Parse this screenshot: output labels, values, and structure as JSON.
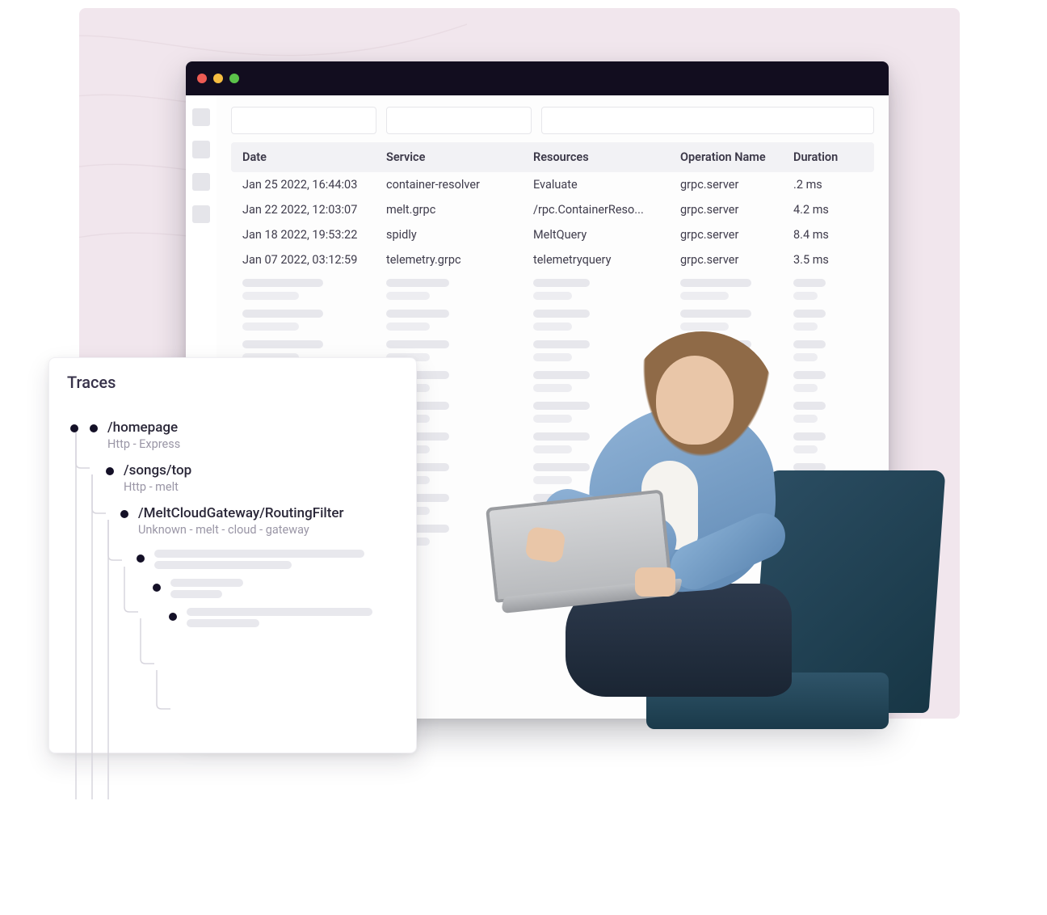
{
  "table": {
    "headers": {
      "date": "Date",
      "service": "Service",
      "resources": "Resources",
      "operation": "Operation Name",
      "duration": "Duration"
    },
    "rows": [
      {
        "date": "Jan 25 2022, 16:44:03",
        "service": "container-resolver",
        "resources": "Evaluate",
        "operation": "grpc.server",
        "duration": ".2 ms"
      },
      {
        "date": "Jan 22 2022, 12:03:07",
        "service": "melt.grpc",
        "resources": "/rpc.ContainerReso...",
        "operation": "grpc.server",
        "duration": "4.2 ms"
      },
      {
        "date": "Jan 18 2022, 19:53:22",
        "service": "spidly",
        "resources": "MeltQuery",
        "operation": "grpc.server",
        "duration": "8.4 ms"
      },
      {
        "date": "Jan 07 2022, 03:12:59",
        "service": "telemetry.grpc",
        "resources": "telemetryquery",
        "operation": "grpc.server",
        "duration": "3.5 ms"
      }
    ]
  },
  "traces": {
    "title": "Traces",
    "nodes": [
      {
        "label": "/homepage",
        "sub": "Http - Express"
      },
      {
        "label": "/songs/top",
        "sub": "Http - melt"
      },
      {
        "label": "/MeltCloudGateway/RoutingFilter",
        "sub": "Unknown - melt - cloud - gateway"
      }
    ]
  }
}
